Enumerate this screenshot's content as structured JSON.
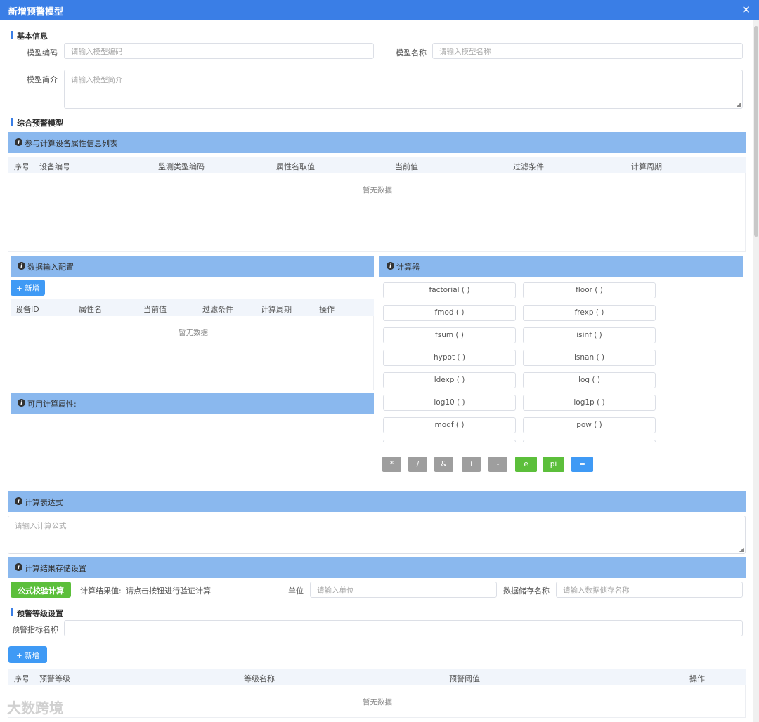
{
  "dialog": {
    "title": "新增预警模型"
  },
  "basic": {
    "section_title": "基本信息",
    "code_label": "模型编码",
    "code_placeholder": "请输入模型编码",
    "name_label": "模型名称",
    "name_placeholder": "请输入模型名称",
    "desc_label": "模型简介",
    "desc_placeholder": "请输入模型简介"
  },
  "composite": {
    "section_title": "综合预警模型",
    "device_list_title": "参与计算设备属性信息列表",
    "device_table": {
      "columns": [
        "序号",
        "设备编号",
        "监测类型编码",
        "属性名取值",
        "当前值",
        "过滤条件",
        "计算周期"
      ],
      "empty_text": "暂无数据"
    },
    "input_config": {
      "title": "数据输入配置",
      "add_label": "+ 新增",
      "columns": [
        "设备ID",
        "属性名",
        "当前值",
        "过滤条件",
        "计算周期",
        "操作"
      ],
      "empty_text": "暂无数据"
    },
    "available_attrs_title": "可用计算属性:",
    "calculator": {
      "title": "计算器",
      "functions": [
        "factorial ( )",
        "floor ( )",
        "fmod ( )",
        "frexp ( )",
        "fsum ( )",
        "isinf ( )",
        "hypot ( )",
        "isnan ( )",
        "ldexp ( )",
        "log ( )",
        "log10 ( )",
        "log1p ( )",
        "modf ( )",
        "pow ( )"
      ],
      "operators": [
        {
          "label": "*",
          "color": "#9e9e9e"
        },
        {
          "label": "/",
          "color": "#9e9e9e"
        },
        {
          "label": "&",
          "color": "#9e9e9e"
        },
        {
          "label": "+",
          "color": "#9e9e9e"
        },
        {
          "label": "-",
          "color": "#9e9e9e"
        },
        {
          "label": "e",
          "color": "#5cbf3b"
        },
        {
          "label": "pi",
          "color": "#5cbf3b"
        },
        {
          "label": "=",
          "color": "#3f9af5"
        }
      ]
    },
    "expression": {
      "title": "计算表达式",
      "placeholder": "请输入计算公式"
    },
    "storage": {
      "title": "计算结果存储设置",
      "validate_label": "公式校验计算",
      "result_label": "计算结果值:",
      "result_hint": "请点击按钮进行验证计算",
      "unit_label": "单位",
      "unit_placeholder": "请输入单位",
      "store_label": "数据储存名称",
      "store_placeholder": "请输入数据储存名称"
    }
  },
  "warning_level": {
    "section_title": "预警等级设置",
    "indicator_label": "预警指标名称",
    "add_label": "+ 新增",
    "columns": [
      "序号",
      "预警等级",
      "等级名称",
      "预警阈值",
      "操作"
    ],
    "empty_text": "暂无数据"
  },
  "watermark": "大数跨境"
}
